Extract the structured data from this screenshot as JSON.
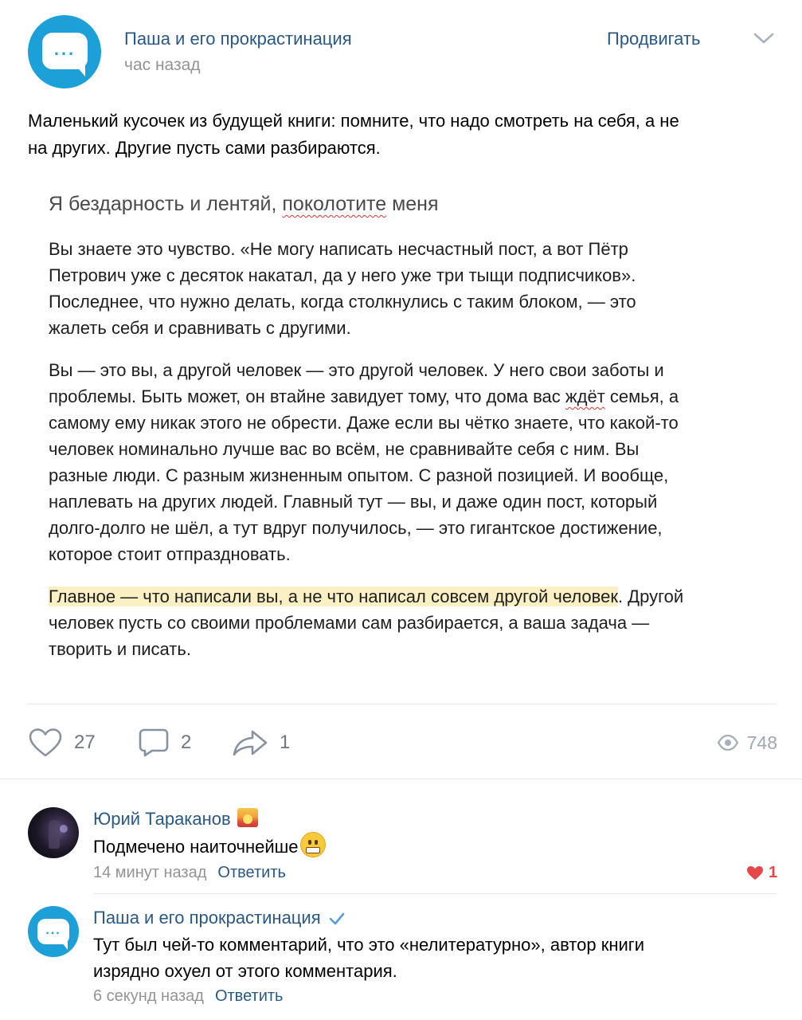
{
  "post": {
    "group_name": "Паша и его прокрастинация",
    "time": "час назад",
    "promote_label": "Продвигать",
    "text_lines": [
      "Маленький кусочек из будущей книги: помните, что надо смотреть на себя, а не",
      "на других. Другие пусть сами разбираются."
    ]
  },
  "document": {
    "title_before": "Я бездарность и лентяй, ",
    "title_misspelled": "поколотите",
    "title_after": " меня",
    "p1_lines": [
      "Вы знаете это чувство. «Не могу написать несчастный пост, а вот Пётр",
      "Петрович уже с десяток накатал, да у него уже три тыщи подписчиков».",
      "Последнее, что нужно делать, когда столкнулись с таким блоком, — это",
      "жалеть себя и сравнивать с другими."
    ],
    "p2_line1": "Вы — это вы, а другой человек — это другой человек. У него свои заботы и",
    "p2_line2_before": "проблемы. Быть может, он втайне завидует тому, что дома вас ",
    "p2_line2_misspelled": "ждёт",
    "p2_line2_after": " семья, а",
    "p2_rest": [
      "самому ему никак этого не обрести. Даже если вы чётко знаете, что какой-то",
      "человек номинально лучше вас во всём, не сравнивайте себя с ним. Вы",
      "разные люди. С разным жизненным опытом. С разной позицией. И вообще,",
      "наплевать на других людей. Главный тут — вы, и даже один пост, который",
      "долго-долго не шёл, а тут вдруг получилось, — это гигантское достижение,",
      "которое стоит отпраздновать."
    ],
    "p3_highlight": "Главное — что написали вы, а не что написал совсем другой человек",
    "p3_line1_after": ". Другой",
    "p3_rest": [
      "человек пусть со своими проблемами сам разбирается, а ваша задача —",
      "творить и писать."
    ]
  },
  "actions": {
    "likes": "27",
    "comments": "2",
    "shares": "1",
    "views": "748"
  },
  "comments": [
    {
      "author": "Юрий Тараканов",
      "text": "Подмечено наиточнейше",
      "time": "14 минут назад",
      "reply_label": "Ответить",
      "likes": "1"
    },
    {
      "author": "Паша и его прокрастинация",
      "text_lines": [
        "Тут был чей-то комментарий, что это «нелитературно», автор книги",
        "изрядно охуел от этого комментария."
      ],
      "time": "6 секунд назад",
      "reply_label": "Ответить"
    }
  ],
  "colors": {
    "link": "#2a5885",
    "brand_blue": "#1da0d8",
    "muted": "#939393",
    "highlight": "#fbf0c4",
    "like_red": "#e64646"
  },
  "icons": [
    "chat-bubble-logo-icon",
    "chevron-down-icon",
    "heart-icon",
    "comment-icon",
    "share-icon",
    "eye-icon",
    "verified-check-icon",
    "sunset-emoji-icon",
    "grimacing-emoji-icon"
  ]
}
